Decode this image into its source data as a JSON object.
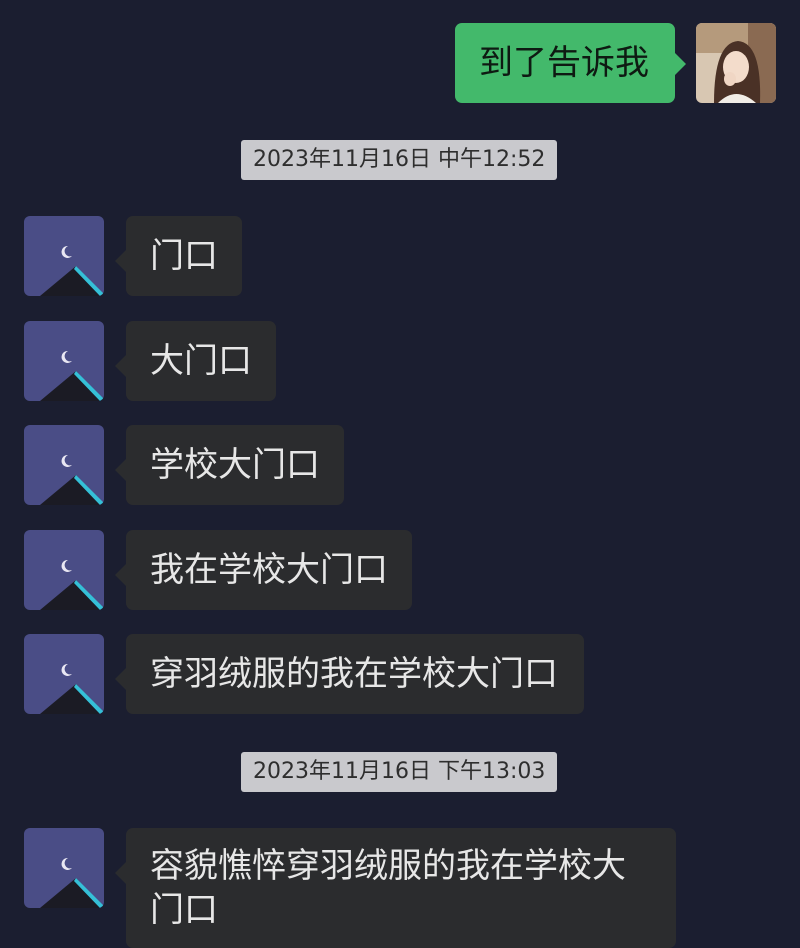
{
  "messages": {
    "sent_1": "到了告诉我",
    "recv_1": "门口",
    "recv_2": "大门口",
    "recv_3": "学校大门口",
    "recv_4": "我在学校大门口",
    "recv_5": "穿羽绒服的我在学校大门口",
    "recv_6": "容貌憔悴穿羽绒服的我在学校大门口"
  },
  "timestamps": {
    "first": "2023年11月16日 中午12:52",
    "second": "2023年11月16日 下午13:03"
  },
  "icons": {
    "sender_avatar": "moon-building-avatar",
    "self_avatar": "girl-photo-avatar"
  },
  "colors": {
    "background": "#1b1e30",
    "incoming_bubble": "#2b2c2e",
    "outgoing_bubble": "#43b96b",
    "timestamp_chip": "#c9c9cd"
  }
}
